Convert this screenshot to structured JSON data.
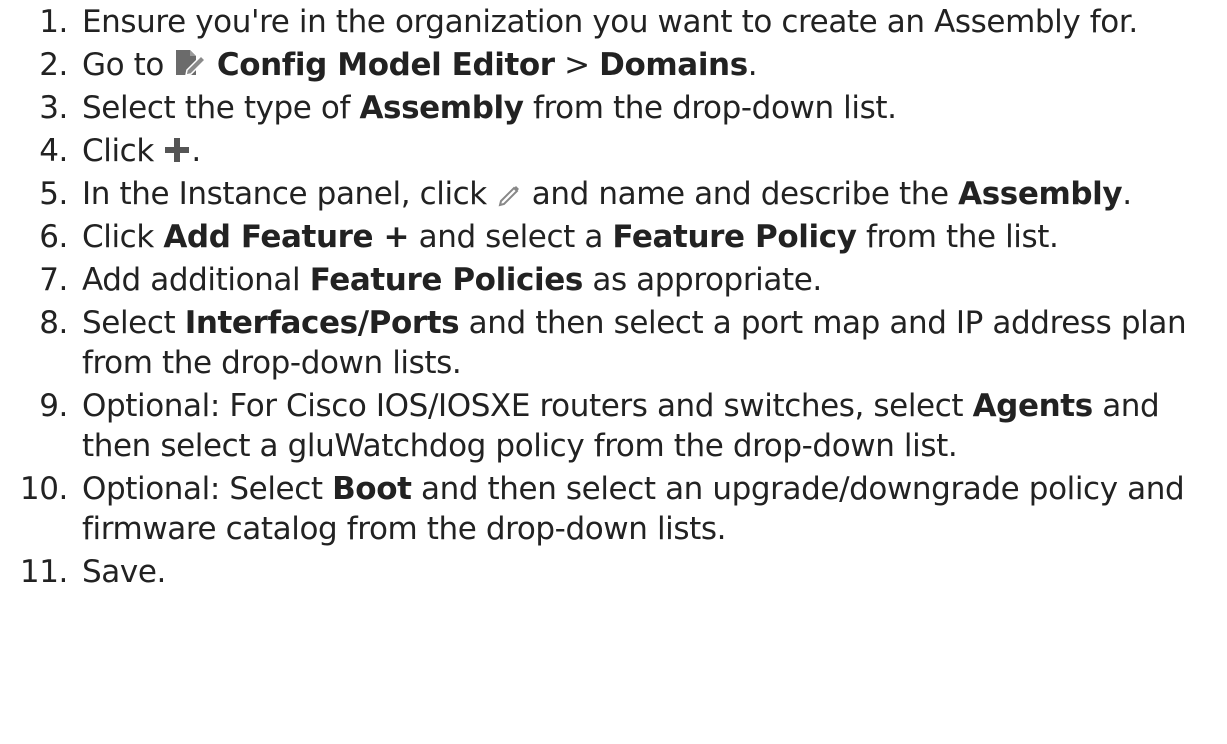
{
  "steps": [
    {
      "number": "1.",
      "parts": [
        {
          "t": "text",
          "v": "Ensure you're in the organization you want to create an Assembly for."
        }
      ]
    },
    {
      "number": "2.",
      "parts": [
        {
          "t": "text",
          "v": "Go to "
        },
        {
          "t": "icon",
          "icon": "config-editor-icon"
        },
        {
          "t": "text",
          "v": " "
        },
        {
          "t": "bold",
          "v": "Config Model Editor"
        },
        {
          "t": "text",
          "v": " > "
        },
        {
          "t": "bold",
          "v": "Domains"
        },
        {
          "t": "text",
          "v": "."
        }
      ]
    },
    {
      "number": "3.",
      "parts": [
        {
          "t": "text",
          "v": "Select the type of "
        },
        {
          "t": "bold",
          "v": "Assembly"
        },
        {
          "t": "text",
          "v": " from the drop-down list."
        }
      ]
    },
    {
      "number": "4.",
      "parts": [
        {
          "t": "text",
          "v": "Click "
        },
        {
          "t": "icon",
          "icon": "plus-icon"
        },
        {
          "t": "text",
          "v": "."
        }
      ]
    },
    {
      "number": "5.",
      "parts": [
        {
          "t": "text",
          "v": "In the Instance panel, click "
        },
        {
          "t": "icon",
          "icon": "pencil-icon"
        },
        {
          "t": "text",
          "v": " and name and describe the "
        },
        {
          "t": "bold",
          "v": "Assembly"
        },
        {
          "t": "text",
          "v": "."
        }
      ]
    },
    {
      "number": "6.",
      "parts": [
        {
          "t": "text",
          "v": "Click "
        },
        {
          "t": "bold",
          "v": "Add Feature +"
        },
        {
          "t": "text",
          "v": " and select a "
        },
        {
          "t": "bold",
          "v": "Feature Policy"
        },
        {
          "t": "text",
          "v": " from the list."
        }
      ]
    },
    {
      "number": "7.",
      "parts": [
        {
          "t": "text",
          "v": "Add additional "
        },
        {
          "t": "bold",
          "v": "Feature Policies"
        },
        {
          "t": "text",
          "v": " as appropriate."
        }
      ]
    },
    {
      "number": "8.",
      "parts": [
        {
          "t": "text",
          "v": "Select "
        },
        {
          "t": "bold",
          "v": "Interfaces/Ports"
        },
        {
          "t": "text",
          "v": " and then select a port map and IP address plan from the drop-down lists."
        }
      ]
    },
    {
      "number": "9.",
      "parts": [
        {
          "t": "text",
          "v": "Optional: For Cisco IOS/IOSXE routers and switches, select "
        },
        {
          "t": "bold",
          "v": "Agents"
        },
        {
          "t": "text",
          "v": " and then select a gluWatchdog policy from the drop-down list."
        }
      ]
    },
    {
      "number": "10.",
      "parts": [
        {
          "t": "text",
          "v": "Optional: Select "
        },
        {
          "t": "bold",
          "v": "Boot"
        },
        {
          "t": "text",
          "v": " and then select an upgrade/downgrade policy and firmware catalog from the drop-down lists."
        }
      ]
    },
    {
      "number": "11.",
      "parts": [
        {
          "t": "text",
          "v": "Save."
        }
      ]
    }
  ],
  "colors": {
    "text": "#222222",
    "icon_editor": "#6b6b6b",
    "icon_plus": "#555555",
    "icon_pencil": "#888888"
  }
}
